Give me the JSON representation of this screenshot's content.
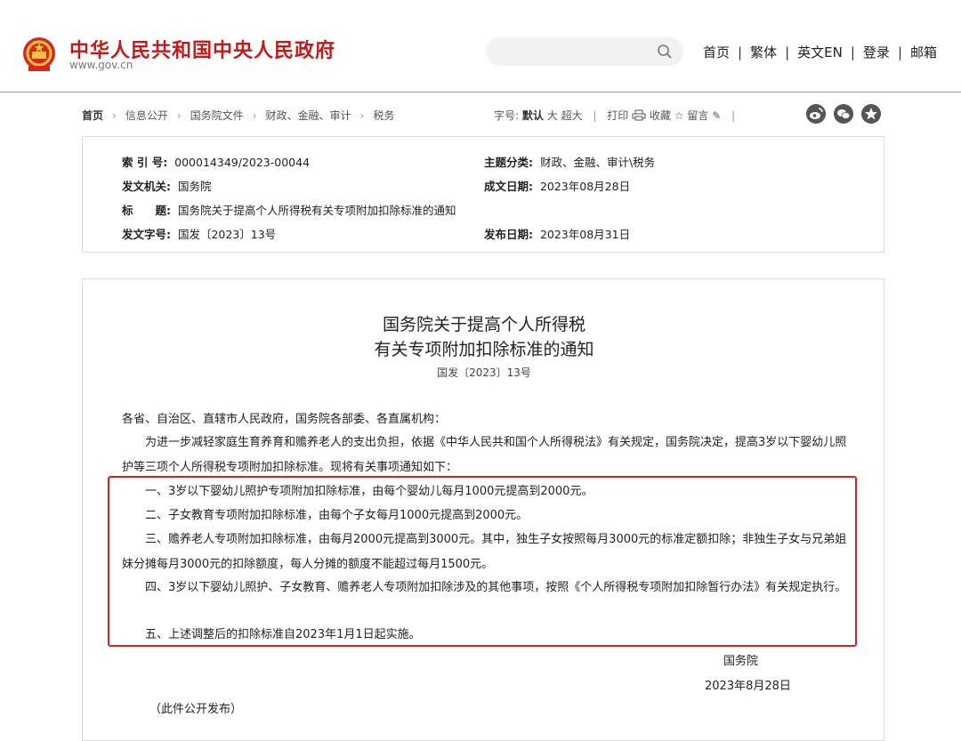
{
  "header": {
    "site_name": "中华人民共和国中央人民政府",
    "site_domain": "www.gov.cn",
    "nav": [
      "首页",
      "繁体",
      "英文EN",
      "登录",
      "邮箱"
    ]
  },
  "breadcrumb": [
    "首页",
    "信息公开",
    "国务院文件",
    "财政、金融、审计",
    "税务"
  ],
  "toolbar": {
    "font_size_label": "字号:",
    "font_default": "默认",
    "font_large": "大",
    "font_xlarge": "超大",
    "print": "打印",
    "favorite": "收藏",
    "comment": "留言"
  },
  "share_icons": [
    "weibo-icon",
    "wechat-icon",
    "qzone-icon"
  ],
  "meta": {
    "index_label": "索 引 号:",
    "index_value": "000014349/2023-00044",
    "category_label": "主题分类:",
    "category_value": "财政、金融、审计\\税务",
    "issuer_label": "发文机关:",
    "issuer_value": "国务院",
    "created_label": "成文日期:",
    "created_value": "2023年08月28日",
    "title_label": "标　　题:",
    "title_value": "国务院关于提高个人所得税有关专项附加扣除标准的通知",
    "docno_label": "发文字号:",
    "docno_value": "国发〔2023〕13号",
    "published_label": "发布日期:",
    "published_value": "2023年08月31日"
  },
  "document": {
    "title_line1": "国务院关于提高个人所得税",
    "title_line2": "有关专项附加扣除标准的通知",
    "doc_number": "国发〔2023〕13号",
    "salutation": "各省、自治区、直辖市人民政府，国务院各部委、各直属机构：",
    "intro": "为进一步减轻家庭生育养育和赡养老人的支出负担，依据《中华人民共和国个人所得税法》有关规定，国务院决定，提高3岁以下婴幼儿照护等三项个人所得税专项附加扣除标准。现将有关事项通知如下：",
    "item1": "一、3岁以下婴幼儿照护专项附加扣除标准，由每个婴幼儿每月1000元提高到2000元。",
    "item2": "二、子女教育专项附加扣除标准，由每个子女每月1000元提高到2000元。",
    "item3": "三、赡养老人专项附加扣除标准，由每月2000元提高到3000元。其中，独生子女按照每月3000元的标准定额扣除；非独生子女与兄弟姐妹分摊每月3000元的扣除额度，每人分摊的额度不能超过每月1500元。",
    "item4": "四、3岁以下婴幼儿照护、子女教育、赡养老人专项附加扣除涉及的其他事项，按照《个人所得税专项附加扣除暂行办法》有关规定执行。",
    "item5": "五、上述调整后的扣除标准自2023年1月1日起实施。",
    "signer": "国务院",
    "sign_date": "2023年8月28日",
    "note": "（此件公开发布）"
  }
}
